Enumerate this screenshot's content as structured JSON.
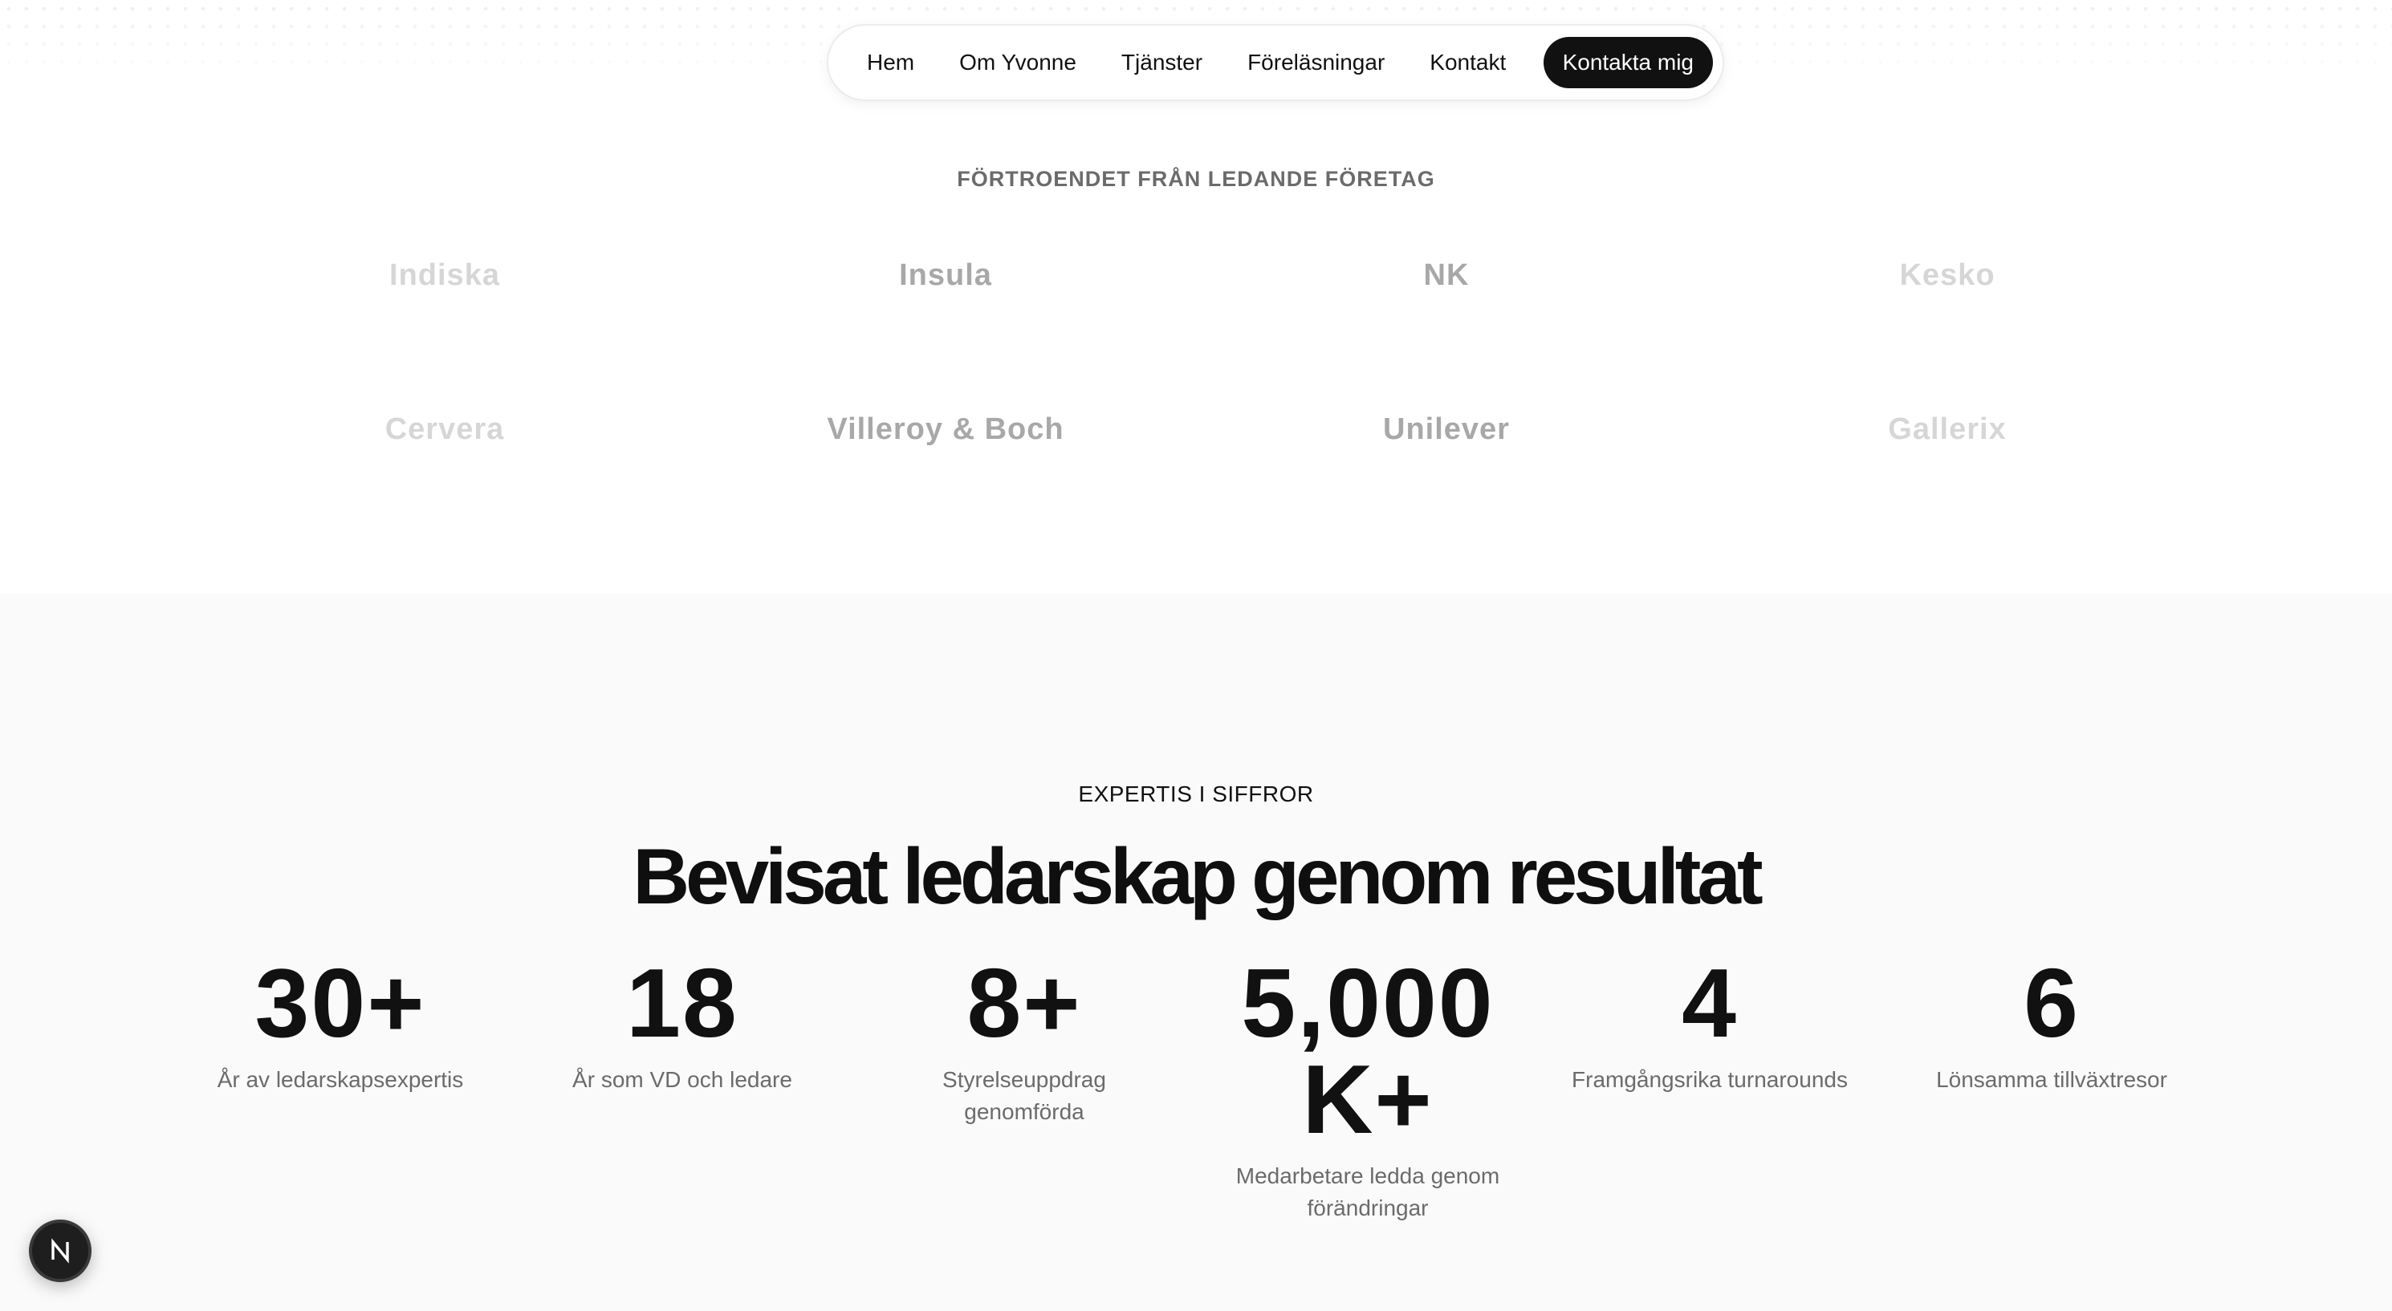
{
  "nav": {
    "items": [
      {
        "label": "Hem"
      },
      {
        "label": "Om Yvonne"
      },
      {
        "label": "Tjänster"
      },
      {
        "label": "Föreläsningar"
      },
      {
        "label": "Kontakt"
      }
    ],
    "cta_label": "Kontakta mig"
  },
  "trusted": {
    "title": "FÖRTROENDET FRÅN LEDANDE FÖRETAG",
    "logos": [
      {
        "name": "Indiska",
        "color": "#d6d6d6"
      },
      {
        "name": "Insula",
        "color": "#a8a8a8"
      },
      {
        "name": "NK",
        "color": "#a8a8a8"
      },
      {
        "name": "Kesko",
        "color": "#d6d6d6"
      },
      {
        "name": "Cervera",
        "color": "#d6d6d6"
      },
      {
        "name": "Villeroy & Boch",
        "color": "#a8a8a8"
      },
      {
        "name": "Unilever",
        "color": "#a8a8a8"
      },
      {
        "name": "Gallerix",
        "color": "#d6d6d6"
      }
    ]
  },
  "stats": {
    "eyebrow": "EXPERTIS I SIFFROR",
    "headline": "Bevisat ledarskap genom resultat",
    "items": [
      {
        "value": "30+",
        "label": "År av ledarskapsexpertis"
      },
      {
        "value": "18",
        "label": "År som VD och ledare"
      },
      {
        "value": "8+",
        "label": "Styrelseuppdrag genomförda"
      },
      {
        "value": "5,000 K+",
        "label": "Medarbetare ledda genom förändringar"
      },
      {
        "value": "4",
        "label": "Framgångsrika turnarounds"
      },
      {
        "value": "6",
        "label": "Lönsamma tillväxtresor"
      }
    ]
  },
  "dev_badge": {
    "letter": "N",
    "icon": "nextjs-icon"
  }
}
